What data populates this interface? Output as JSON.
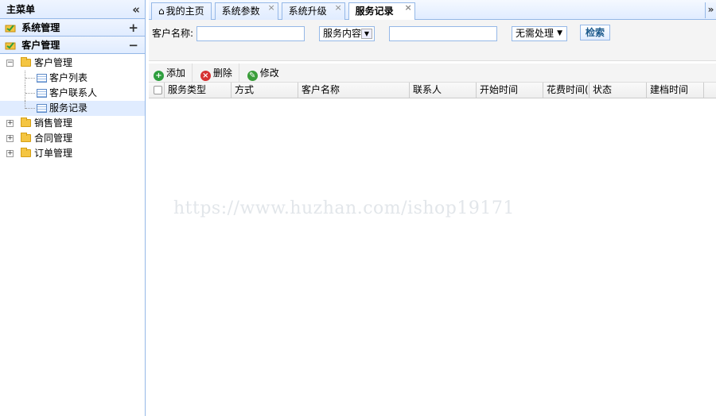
{
  "sidebar": {
    "title": "主菜单",
    "collapse_glyph": "«",
    "sections": [
      {
        "label": "系统管理",
        "tool": "+"
      },
      {
        "label": "客户管理",
        "tool": "−"
      }
    ],
    "tree": {
      "customer_folder": "客户管理",
      "customer_children": [
        "客户列表",
        "客户联系人",
        "服务记录"
      ],
      "other_folders": [
        "销售管理",
        "合同管理",
        "订单管理"
      ]
    }
  },
  "tabs": {
    "items": [
      "我的主页",
      "系统参数",
      "系统升级",
      "服务记录"
    ],
    "active": "服务记录",
    "scroll_glyph": "»"
  },
  "search": {
    "customer_name_label": "客户名称:",
    "customer_name_value": "",
    "service_content_select": "服务内容",
    "service_content_value": "",
    "status_select": "无需处理",
    "search_button": "检索"
  },
  "toolbar": {
    "add": "添加",
    "delete": "删除",
    "edit": "修改"
  },
  "grid": {
    "columns": [
      "服务类型",
      "方式",
      "客户名称",
      "联系人",
      "开始时间",
      "花费时间(分",
      "状态",
      "建档时间"
    ]
  },
  "watermark": "https://www.huzhan.com/ishop19171",
  "colors": {
    "border": "#95b8e7",
    "header_bg": "#e0ecff",
    "selected_bg": "#e0ecff"
  }
}
